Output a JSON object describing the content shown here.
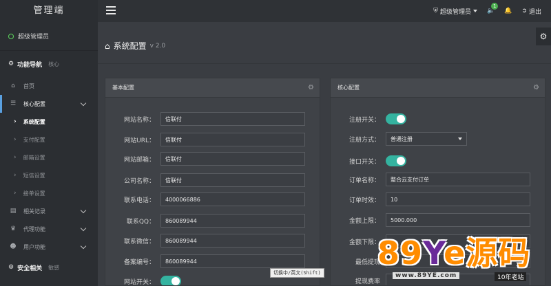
{
  "brand": "管理端",
  "topbar": {
    "admin_label": "超级管理员",
    "notify_count": "1",
    "logout_label": "退出"
  },
  "sidebar": {
    "user": "超级管理员",
    "nav_title": "功能导航",
    "nav_sub": "核心",
    "items": [
      {
        "label": "首页"
      },
      {
        "label": "核心配置"
      },
      {
        "label": "系统配置"
      },
      {
        "label": "支付配置"
      },
      {
        "label": "邮箱设置"
      },
      {
        "label": "短信设置"
      },
      {
        "label": "接单设置"
      },
      {
        "label": "相关记录"
      },
      {
        "label": "代理功能"
      },
      {
        "label": "用户功能"
      }
    ],
    "security_title": "安全相关",
    "security_sub": "敏感"
  },
  "page": {
    "title": "系统配置",
    "version": "v 2.0"
  },
  "basic": {
    "heading": "基本配置",
    "fields": [
      {
        "label": "网站名称：",
        "value": "信联付"
      },
      {
        "label": "网站URL：",
        "value": "信联付"
      },
      {
        "label": "网站邮箱：",
        "value": "信联付"
      },
      {
        "label": "公司名称：",
        "value": "信联付"
      },
      {
        "label": "联系电话：",
        "value": "4000066886"
      },
      {
        "label": "联系QQ：",
        "value": "860089944"
      },
      {
        "label": "联系微信：",
        "value": "860089944"
      },
      {
        "label": "备案编号：",
        "value": "860089944"
      }
    ],
    "switch_label": "网站开关："
  },
  "core": {
    "heading": "核心配置",
    "register_switch_label": "注册开关：",
    "register_mode_label": "注册方式：",
    "register_mode_value": "普通注册",
    "api_switch_label": "接口开关：",
    "order_name_label": "订单名称：",
    "order_name_value": "整合云支付订单",
    "order_timeout_label": "订单时效：",
    "order_timeout_value": "10",
    "amount_max_label": "金额上限：",
    "amount_max_value": "5000.000",
    "amount_min_label": "金额下限：",
    "withdraw_min_label": "最低提现",
    "withdraw_fee_label": "提现费率"
  },
  "ime": "切换中/英文(Shift)",
  "watermark": {
    "main_a": "89",
    "main_y": "Y",
    "main_b": "e源码",
    "url": "www.89YE.com",
    "tag": "10年老站"
  }
}
